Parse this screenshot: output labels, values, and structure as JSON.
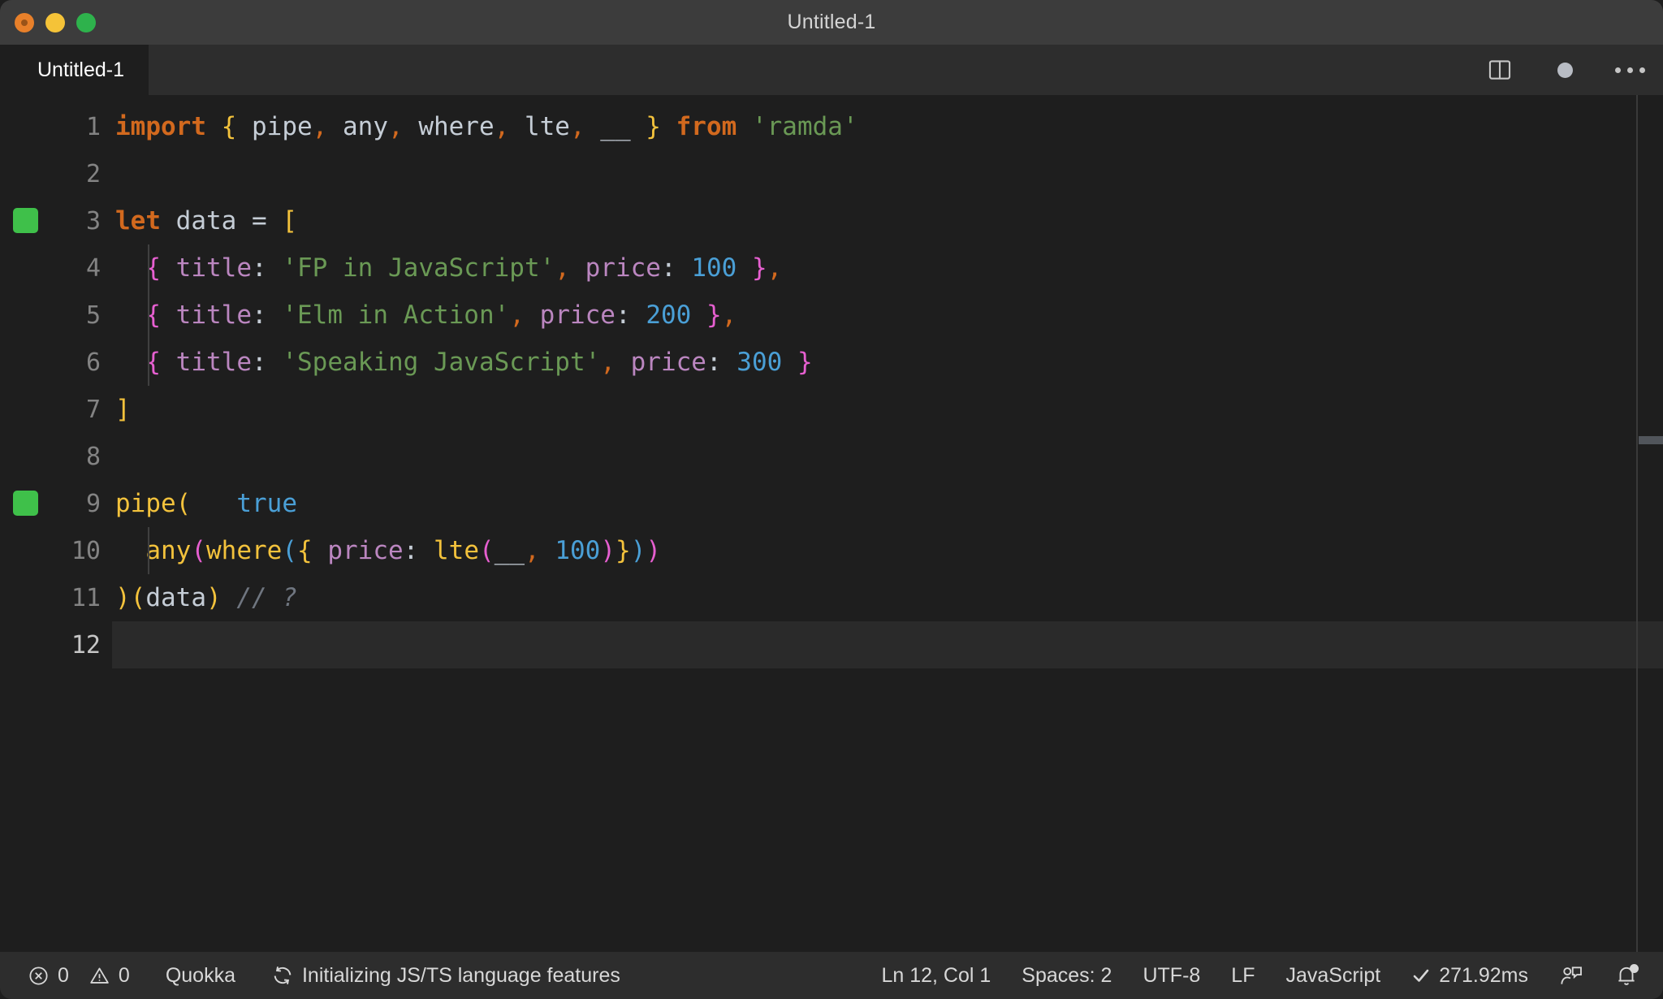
{
  "window": {
    "title": "Untitled-1",
    "traffic_lights": [
      "close-button",
      "minimize-button",
      "maximize-button"
    ]
  },
  "tabbar": {
    "active_tab": "Untitled-1",
    "actions": {
      "split_editor": "split-editor-icon",
      "unsaved_indicator": "unsaved-dot-icon",
      "more_actions": "more-actions-icon"
    }
  },
  "editor": {
    "language": "JavaScript",
    "lines": [
      {
        "number": "1",
        "marker": false,
        "indent_guide": false,
        "active": false,
        "tokens": [
          {
            "t": "import",
            "c": "t-kw"
          },
          {
            "t": " ",
            "c": "t-plain"
          },
          {
            "t": "{",
            "c": "t-b1"
          },
          {
            "t": " pipe",
            "c": "t-plain"
          },
          {
            "t": ",",
            "c": "t-punc"
          },
          {
            "t": " any",
            "c": "t-plain"
          },
          {
            "t": ",",
            "c": "t-punc"
          },
          {
            "t": " where",
            "c": "t-plain"
          },
          {
            "t": ",",
            "c": "t-punc"
          },
          {
            "t": " lte",
            "c": "t-plain"
          },
          {
            "t": ",",
            "c": "t-punc"
          },
          {
            "t": " __ ",
            "c": "t-plain"
          },
          {
            "t": "}",
            "c": "t-b1"
          },
          {
            "t": " ",
            "c": "t-plain"
          },
          {
            "t": "from",
            "c": "t-kw"
          },
          {
            "t": " ",
            "c": "t-plain"
          },
          {
            "t": "'ramda'",
            "c": "t-str"
          }
        ]
      },
      {
        "number": "2",
        "marker": false,
        "indent_guide": false,
        "active": false,
        "tokens": []
      },
      {
        "number": "3",
        "marker": true,
        "indent_guide": false,
        "active": false,
        "tokens": [
          {
            "t": "let",
            "c": "t-kw"
          },
          {
            "t": " data ",
            "c": "t-plain"
          },
          {
            "t": "=",
            "c": "t-plain"
          },
          {
            "t": " ",
            "c": "t-plain"
          },
          {
            "t": "[",
            "c": "t-b1"
          }
        ]
      },
      {
        "number": "4",
        "marker": false,
        "indent_guide": true,
        "active": false,
        "tokens": [
          {
            "t": "  ",
            "c": "t-plain"
          },
          {
            "t": "{",
            "c": "t-b2"
          },
          {
            "t": " ",
            "c": "t-plain"
          },
          {
            "t": "title",
            "c": "t-prop"
          },
          {
            "t": ":",
            "c": "t-plain"
          },
          {
            "t": " ",
            "c": "t-plain"
          },
          {
            "t": "'FP in JavaScript'",
            "c": "t-str"
          },
          {
            "t": ",",
            "c": "t-punc"
          },
          {
            "t": " ",
            "c": "t-plain"
          },
          {
            "t": "price",
            "c": "t-prop"
          },
          {
            "t": ":",
            "c": "t-plain"
          },
          {
            "t": " ",
            "c": "t-plain"
          },
          {
            "t": "100",
            "c": "t-num"
          },
          {
            "t": " ",
            "c": "t-plain"
          },
          {
            "t": "}",
            "c": "t-b2"
          },
          {
            "t": ",",
            "c": "t-punc"
          }
        ]
      },
      {
        "number": "5",
        "marker": false,
        "indent_guide": true,
        "active": false,
        "tokens": [
          {
            "t": "  ",
            "c": "t-plain"
          },
          {
            "t": "{",
            "c": "t-b2"
          },
          {
            "t": " ",
            "c": "t-plain"
          },
          {
            "t": "title",
            "c": "t-prop"
          },
          {
            "t": ":",
            "c": "t-plain"
          },
          {
            "t": " ",
            "c": "t-plain"
          },
          {
            "t": "'Elm in Action'",
            "c": "t-str"
          },
          {
            "t": ",",
            "c": "t-punc"
          },
          {
            "t": " ",
            "c": "t-plain"
          },
          {
            "t": "price",
            "c": "t-prop"
          },
          {
            "t": ":",
            "c": "t-plain"
          },
          {
            "t": " ",
            "c": "t-plain"
          },
          {
            "t": "200",
            "c": "t-num"
          },
          {
            "t": " ",
            "c": "t-plain"
          },
          {
            "t": "}",
            "c": "t-b2"
          },
          {
            "t": ",",
            "c": "t-punc"
          }
        ]
      },
      {
        "number": "6",
        "marker": false,
        "indent_guide": true,
        "active": false,
        "tokens": [
          {
            "t": "  ",
            "c": "t-plain"
          },
          {
            "t": "{",
            "c": "t-b2"
          },
          {
            "t": " ",
            "c": "t-plain"
          },
          {
            "t": "title",
            "c": "t-prop"
          },
          {
            "t": ":",
            "c": "t-plain"
          },
          {
            "t": " ",
            "c": "t-plain"
          },
          {
            "t": "'Speaking JavaScript'",
            "c": "t-str"
          },
          {
            "t": ",",
            "c": "t-punc"
          },
          {
            "t": " ",
            "c": "t-plain"
          },
          {
            "t": "price",
            "c": "t-prop"
          },
          {
            "t": ":",
            "c": "t-plain"
          },
          {
            "t": " ",
            "c": "t-plain"
          },
          {
            "t": "300",
            "c": "t-num"
          },
          {
            "t": " ",
            "c": "t-plain"
          },
          {
            "t": "}",
            "c": "t-b2"
          }
        ]
      },
      {
        "number": "7",
        "marker": false,
        "indent_guide": false,
        "active": false,
        "tokens": [
          {
            "t": "]",
            "c": "t-b1"
          }
        ]
      },
      {
        "number": "8",
        "marker": false,
        "indent_guide": false,
        "active": false,
        "tokens": []
      },
      {
        "number": "9",
        "marker": true,
        "indent_guide": false,
        "active": false,
        "tokens": [
          {
            "t": "pipe",
            "c": "t-fn"
          },
          {
            "t": "(",
            "c": "t-b1"
          },
          {
            "t": "   ",
            "c": "t-plain"
          },
          {
            "t": "true",
            "c": "t-num"
          }
        ]
      },
      {
        "number": "10",
        "marker": false,
        "indent_guide": true,
        "active": false,
        "tokens": [
          {
            "t": "  ",
            "c": "t-plain"
          },
          {
            "t": "any",
            "c": "t-fn"
          },
          {
            "t": "(",
            "c": "t-b2"
          },
          {
            "t": "where",
            "c": "t-fn"
          },
          {
            "t": "(",
            "c": "t-b3"
          },
          {
            "t": "{",
            "c": "t-b1"
          },
          {
            "t": " ",
            "c": "t-plain"
          },
          {
            "t": "price",
            "c": "t-prop"
          },
          {
            "t": ":",
            "c": "t-plain"
          },
          {
            "t": " ",
            "c": "t-plain"
          },
          {
            "t": "lte",
            "c": "t-fn"
          },
          {
            "t": "(",
            "c": "t-b2"
          },
          {
            "t": "__",
            "c": "t-plain"
          },
          {
            "t": ",",
            "c": "t-punc"
          },
          {
            "t": " ",
            "c": "t-plain"
          },
          {
            "t": "100",
            "c": "t-num"
          },
          {
            "t": ")",
            "c": "t-b2"
          },
          {
            "t": "}",
            "c": "t-b1"
          },
          {
            "t": ")",
            "c": "t-b3"
          },
          {
            "t": ")",
            "c": "t-b2"
          }
        ]
      },
      {
        "number": "11",
        "marker": false,
        "indent_guide": false,
        "active": false,
        "tokens": [
          {
            "t": ")",
            "c": "t-b1"
          },
          {
            "t": "(",
            "c": "t-b1"
          },
          {
            "t": "data",
            "c": "t-plain"
          },
          {
            "t": ")",
            "c": "t-b1"
          },
          {
            "t": " ",
            "c": "t-plain"
          },
          {
            "t": "// ?",
            "c": "t-comment"
          }
        ]
      },
      {
        "number": "12",
        "marker": false,
        "indent_guide": false,
        "active": true,
        "tokens": []
      }
    ]
  },
  "statusbar": {
    "errors_icon": "error-circle-icon",
    "errors_count": "0",
    "warnings_icon": "warning-triangle-icon",
    "warnings_count": "0",
    "quokka_label": "Quokka",
    "sync_icon": "sync-icon",
    "language_status": "Initializing JS/TS language features",
    "cursor_position": "Ln 12, Col 1",
    "indentation": "Spaces: 2",
    "encoding": "UTF-8",
    "eol": "LF",
    "language_mode": "JavaScript",
    "run_check_icon": "checkmark-icon",
    "run_time": "271.92ms",
    "feedback_icon": "feedback-person-icon",
    "bell_icon": "bell-icon"
  },
  "colors": {
    "titlebar_bg": "#3c3c3c",
    "tabbar_bg": "#2d2d2d",
    "editor_bg": "#1e1e1e",
    "statusbar_bg": "#2d2d2d",
    "quokka_marker_green": "#3fc04a",
    "keyword_orange": "#d2691e",
    "string_green": "#6a9955",
    "number_blue": "#4a9fd6",
    "property_purple": "#bb86c0",
    "function_yellow": "#f3c23c",
    "bracket_pink": "#e65fd0"
  }
}
